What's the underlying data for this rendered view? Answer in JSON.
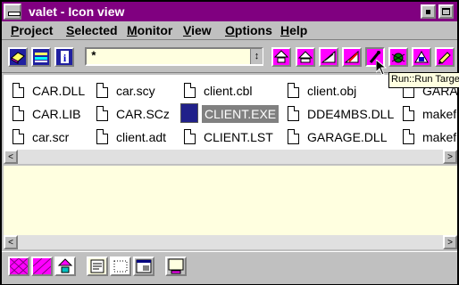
{
  "window": {
    "title": "valet - Icon view"
  },
  "menubar": {
    "items": [
      "Project",
      "Selected",
      "Monitor",
      "View",
      "Options",
      "Help"
    ]
  },
  "toolbar": {
    "filter_value": "*",
    "filter_dropdown_glyph": "↕",
    "left_buttons": [
      "project-icon",
      "list-icon",
      "info-icon"
    ],
    "right_buttons": [
      "build-up-icon",
      "build-icon",
      "make-icon",
      "compile-icon",
      "run-icon",
      "debug-icon",
      "browse-icon",
      "edit-icon"
    ]
  },
  "files": [
    "CAR.DLL",
    "car.scy",
    "client.cbl",
    "client.obj",
    "GARAGE",
    "CAR.LIB",
    "CAR.SCz",
    "CLIENT.EXE",
    "DDE4MBS.DLL",
    "makefile",
    "car.scr",
    "client.adt",
    "CLIENT.LST",
    "GARAGE.DLL",
    "makefi"
  ],
  "selected_file": "CLIENT.EXE",
  "tooltip": "Run::Run Target",
  "scroll_arrows": {
    "left": "<",
    "right": ">"
  },
  "bottom_buttons": [
    "grid-icon",
    "hatch-icon",
    "tree-icon",
    "notes-icon",
    "dotted-icon",
    "window-icon",
    "monitor-icon"
  ],
  "colors": {
    "titlebar": "#800080",
    "toolbar_pink": "#ff00ff",
    "filter_bg": "#ffffe0",
    "log_bg": "#ffffe0",
    "selection": "#808080"
  }
}
